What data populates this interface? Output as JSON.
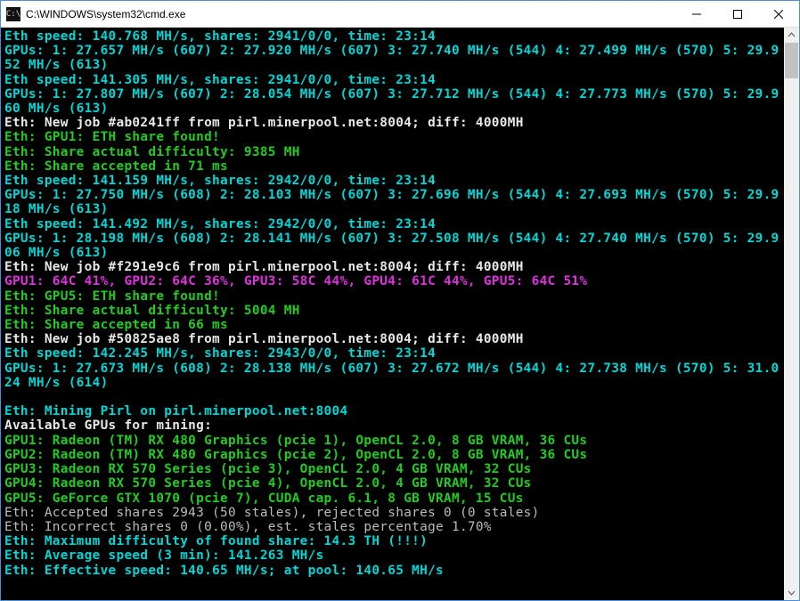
{
  "window": {
    "title": "C:\\WINDOWS\\system32\\cmd.exe",
    "icon_glyph": "C:\\"
  },
  "colors": {
    "cyan": "#00d7d7",
    "green": "#22cc22",
    "white": "#e8e8e8",
    "magenta": "#e030e0",
    "gray": "#bbbbbb",
    "bg": "#000000"
  },
  "lines": [
    {
      "cls": "c-cyan",
      "t": "Eth speed: 140.768 MH/s, shares: 2941/0/0, time: 23:14"
    },
    {
      "cls": "c-cyan",
      "t": "GPUs: 1: 27.657 MH/s (607) 2: 27.920 MH/s (607) 3: 27.740 MH/s (544) 4: 27.499 MH/s (570) 5: 29.952 MH/s (613)"
    },
    {
      "cls": "c-cyan",
      "t": "Eth speed: 141.305 MH/s, shares: 2941/0/0, time: 23:14"
    },
    {
      "cls": "c-cyan",
      "t": "GPUs: 1: 27.807 MH/s (607) 2: 28.054 MH/s (607) 3: 27.712 MH/s (544) 4: 27.773 MH/s (570) 5: 29.960 MH/s (613)"
    },
    {
      "cls": "c-white",
      "t": "Eth: New job #ab0241ff from pirl.minerpool.net:8004; diff: 4000MH"
    },
    {
      "cls": "c-green",
      "t": "Eth: GPU1: ETH share found!"
    },
    {
      "cls": "c-green",
      "t": "Eth: Share actual difficulty: 9385 MH"
    },
    {
      "cls": "c-green",
      "t": "Eth: Share accepted in 71 ms"
    },
    {
      "cls": "c-cyan",
      "t": "Eth speed: 141.159 MH/s, shares: 2942/0/0, time: 23:14"
    },
    {
      "cls": "c-cyan",
      "t": "GPUs: 1: 27.750 MH/s (608) 2: 28.103 MH/s (607) 3: 27.696 MH/s (544) 4: 27.693 MH/s (570) 5: 29.918 MH/s (613)"
    },
    {
      "cls": "c-cyan",
      "t": "Eth speed: 141.492 MH/s, shares: 2942/0/0, time: 23:14"
    },
    {
      "cls": "c-cyan",
      "t": "GPUs: 1: 28.198 MH/s (608) 2: 28.141 MH/s (607) 3: 27.508 MH/s (544) 4: 27.740 MH/s (570) 5: 29.906 MH/s (613)"
    },
    {
      "cls": "c-white",
      "t": "Eth: New job #f291e9c6 from pirl.minerpool.net:8004; diff: 4000MH"
    },
    {
      "cls": "c-magenta",
      "t": "GPU1: 64C 41%, GPU2: 64C 36%, GPU3: 58C 44%, GPU4: 61C 44%, GPU5: 64C 51%"
    },
    {
      "cls": "c-green",
      "t": "Eth: GPU5: ETH share found!"
    },
    {
      "cls": "c-green",
      "t": "Eth: Share actual difficulty: 5004 MH"
    },
    {
      "cls": "c-green",
      "t": "Eth: Share accepted in 66 ms"
    },
    {
      "cls": "c-white",
      "t": "Eth: New job #50825ae8 from pirl.minerpool.net:8004; diff: 4000MH"
    },
    {
      "cls": "c-cyan",
      "t": "Eth speed: 142.245 MH/s, shares: 2943/0/0, time: 23:14"
    },
    {
      "cls": "c-cyan",
      "t": "GPUs: 1: 27.673 MH/s (608) 2: 28.138 MH/s (607) 3: 27.672 MH/s (544) 4: 27.738 MH/s (570) 5: 31.024 MH/s (614)"
    },
    {
      "cls": "c-gray",
      "t": " "
    },
    {
      "cls": "c-cyan",
      "t": "Eth: Mining Pirl on pirl.minerpool.net:8004"
    },
    {
      "cls": "c-white",
      "t": "Available GPUs for mining:"
    },
    {
      "cls": "c-green",
      "t": "GPU1: Radeon (TM) RX 480 Graphics (pcie 1), OpenCL 2.0, 8 GB VRAM, 36 CUs"
    },
    {
      "cls": "c-green",
      "t": "GPU2: Radeon (TM) RX 480 Graphics (pcie 2), OpenCL 2.0, 8 GB VRAM, 36 CUs"
    },
    {
      "cls": "c-green",
      "t": "GPU3: Radeon RX 570 Series (pcie 3), OpenCL 2.0, 4 GB VRAM, 32 CUs"
    },
    {
      "cls": "c-green",
      "t": "GPU4: Radeon RX 570 Series (pcie 4), OpenCL 2.0, 4 GB VRAM, 32 CUs"
    },
    {
      "cls": "c-green",
      "t": "GPU5: GeForce GTX 1070 (pcie 7), CUDA cap. 6.1, 8 GB VRAM, 15 CUs"
    },
    {
      "cls": "c-gray",
      "t": "Eth: Accepted shares 2943 (50 stales), rejected shares 0 (0 stales)"
    },
    {
      "cls": "c-gray",
      "t": "Eth: Incorrect shares 0 (0.00%), est. stales percentage 1.70%"
    },
    {
      "cls": "c-cyan",
      "t": "Eth: Maximum difficulty of found share: 14.3 TH (!!!)"
    },
    {
      "cls": "c-cyan",
      "t": "Eth: Average speed (3 min): 141.263 MH/s"
    },
    {
      "cls": "c-cyan",
      "t": "Eth: Effective speed: 140.65 MH/s; at pool: 140.65 MH/s"
    }
  ]
}
